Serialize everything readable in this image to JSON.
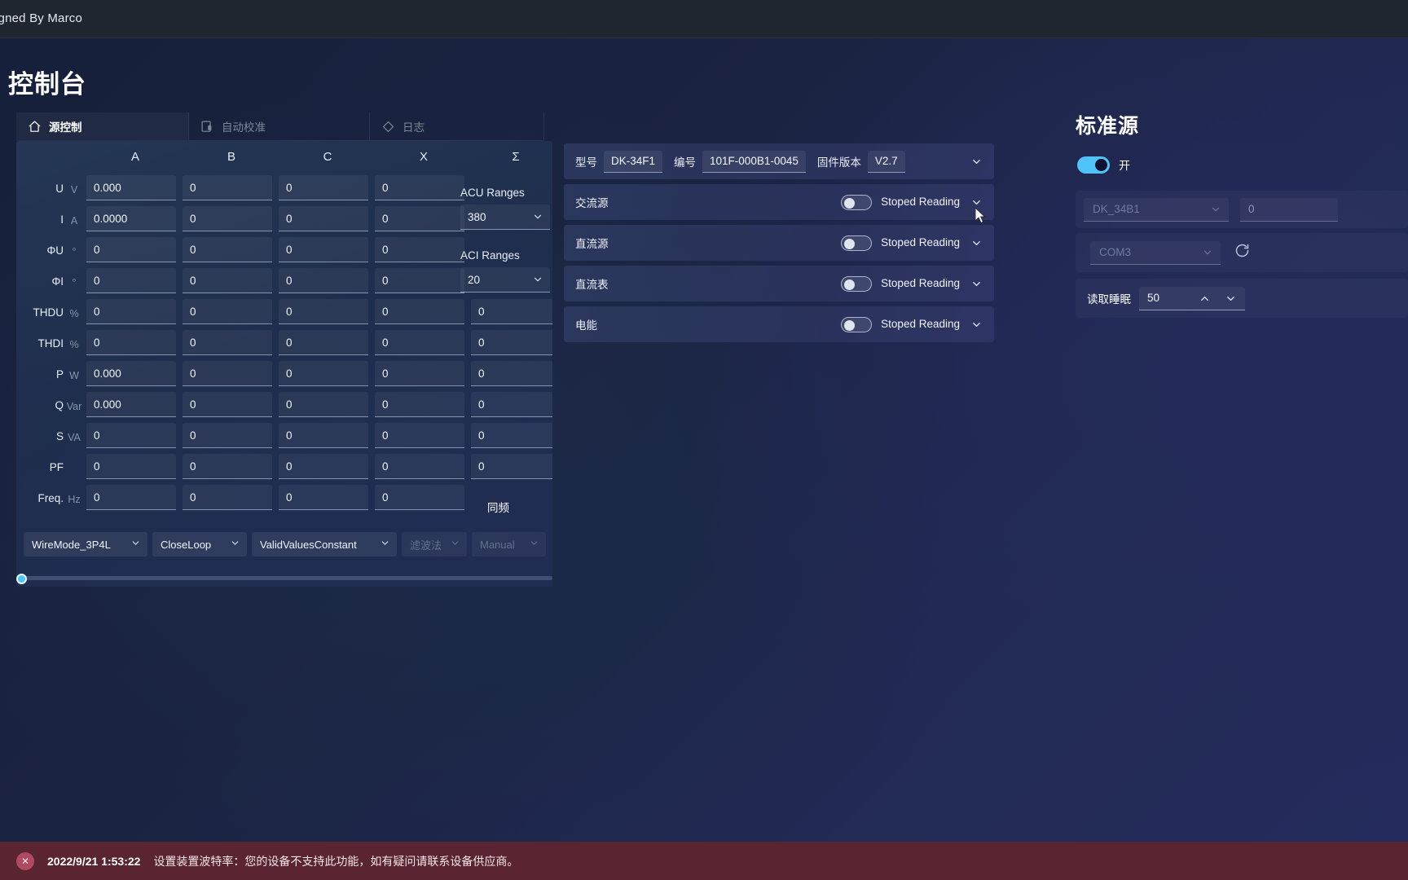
{
  "titlebar": {
    "brand": "igned By Marco"
  },
  "page": {
    "title": "控制台"
  },
  "tabs": [
    {
      "label": "源控制",
      "icon": "home-icon",
      "active": true
    },
    {
      "label": "自动校准",
      "icon": "calibrate-icon",
      "active": false
    },
    {
      "label": "日志",
      "icon": "diamond-icon",
      "active": false
    }
  ],
  "measure": {
    "columns": [
      "A",
      "B",
      "C",
      "X",
      "Σ"
    ],
    "rows": [
      {
        "label": "U",
        "unit": "V",
        "values": [
          "0.000",
          "0",
          "0",
          "0",
          ""
        ]
      },
      {
        "label": "I",
        "unit": "A",
        "values": [
          "0.0000",
          "0",
          "0",
          "0",
          ""
        ]
      },
      {
        "label": "ΦU",
        "unit": "°",
        "values": [
          "0",
          "0",
          "0",
          "0",
          ""
        ]
      },
      {
        "label": "ΦI",
        "unit": "°",
        "values": [
          "0",
          "0",
          "0",
          "0",
          ""
        ]
      },
      {
        "label": "THDU",
        "unit": "%",
        "values": [
          "0",
          "0",
          "0",
          "0",
          "0"
        ]
      },
      {
        "label": "THDI",
        "unit": "%",
        "values": [
          "0",
          "0",
          "0",
          "0",
          "0"
        ]
      },
      {
        "label": "P",
        "unit": "W",
        "values": [
          "0.000",
          "0",
          "0",
          "0",
          "0"
        ]
      },
      {
        "label": "Q",
        "unit": "Var",
        "values": [
          "0.000",
          "0",
          "0",
          "0",
          "0"
        ]
      },
      {
        "label": "S",
        "unit": "VA",
        "values": [
          "0",
          "0",
          "0",
          "0",
          "0"
        ]
      },
      {
        "label": "PF",
        "unit": "",
        "values": [
          "0",
          "0",
          "0",
          "0",
          "0"
        ]
      },
      {
        "label": "Freq.",
        "unit": "Hz",
        "values": [
          "0",
          "0",
          "0",
          "0",
          ""
        ]
      }
    ],
    "acu_label": "ACU Ranges",
    "acu_value": "380",
    "aci_label": "ACI Ranges",
    "aci_value": "20",
    "sync_freq_label": "同频",
    "selectors": [
      {
        "value": "WireMode_3P4L",
        "disabled": false
      },
      {
        "value": "CloseLoop",
        "disabled": false
      },
      {
        "value": "ValidValuesConstant",
        "disabled": false
      },
      {
        "value": "滤波法",
        "disabled": true
      },
      {
        "value": "Manual",
        "disabled": true
      }
    ],
    "scroll_position": 0
  },
  "device": {
    "info": {
      "model_label": "型号",
      "model_value": "DK-34F1",
      "serial_label": "编号",
      "serial_value": "101F-000B1-0045",
      "firmware_label": "固件版本",
      "firmware_value": "V2.7"
    },
    "sources": [
      {
        "name": "交流源",
        "status": "Stoped Reading",
        "enabled": false
      },
      {
        "name": "直流源",
        "status": "Stoped Reading",
        "enabled": false
      },
      {
        "name": "直流表",
        "status": "Stoped Reading",
        "enabled": false
      },
      {
        "name": "电能",
        "status": "Stoped Reading",
        "enabled": false
      }
    ]
  },
  "standard_source": {
    "title": "标准源",
    "power_label": "开",
    "power_on": true,
    "device_value": "DK_34B1",
    "address_value": "0",
    "port_value": "COM3",
    "refresh_icon": "refresh-icon",
    "sleep_label": "读取睡眠",
    "sleep_value": "50"
  },
  "statusbar": {
    "icon": "error-icon",
    "timestamp": "2022/9/21 1:53:22",
    "message": "设置装置波特率：您的设备不支持此功能，如有疑问请联系设备供应商。"
  },
  "colors": {
    "accent": "#4fc3f7",
    "error_bar": "#5a2430",
    "titlebar": "#20262f"
  }
}
